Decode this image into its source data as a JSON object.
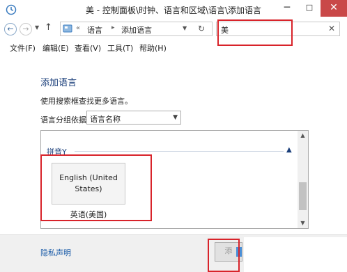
{
  "window": {
    "title": "美 - 控制面板\\时钟、语言和区域\\语言\\添加语言",
    "minimize_glyph": "─",
    "maximize_glyph": "□",
    "close_glyph": "✕"
  },
  "address": {
    "back_glyph": "←",
    "forward_glyph": "→",
    "dropdown_glyph": "▼",
    "up_glyph": "↑",
    "overflow_glyph": "«",
    "crumbs": [
      "语言",
      "添加语言"
    ],
    "crumb_sep_glyph": "▸",
    "refresh_glyph": "↻"
  },
  "search": {
    "value": "美",
    "clear_glyph": "✕"
  },
  "menu": [
    "文件(F)",
    "编辑(E)",
    "查看(V)",
    "工具(T)",
    "帮助(H)"
  ],
  "main": {
    "heading": "添加语言",
    "description": "使用搜索框查找更多语言。",
    "group_by_label": "语言分组依据:",
    "group_by_value": "语言名称",
    "group_header": "拼音Y",
    "language_tile_name": "English (United States)",
    "language_tile_caption": "英语(美国)"
  },
  "footer": {
    "privacy_link": "隐私声明",
    "add_button": "添"
  },
  "colors": {
    "highlight": "#d8232a",
    "link": "#1a5ba8",
    "heading": "#1a3e7a"
  },
  "icons": {
    "title": "globe-clock-icon",
    "address": "control-panel-icon"
  }
}
